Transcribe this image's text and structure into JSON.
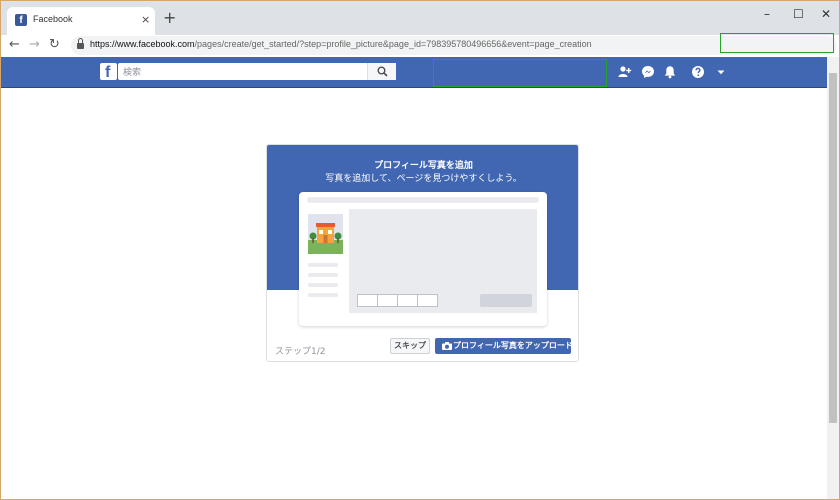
{
  "browser": {
    "tab_title": "Facebook",
    "tab_close": "×",
    "new_tab": "+",
    "minimize": "–",
    "maximize": "☐",
    "close": "✕",
    "url_host": "https://www.facebook.com",
    "url_path": "/pages/create/get_started/?step=profile_picture&page_id=798395780496656&event=page_creation"
  },
  "fb_header": {
    "logo_letter": "f",
    "search_placeholder": "検索"
  },
  "card": {
    "title": "プロフィール写真を追加",
    "subtitle": "写真を追加して、ページを見つけやすくしよう。",
    "step": "ステップ1/2",
    "skip": "スキップ",
    "upload": "プロフィール写真をアップロード"
  },
  "colors": {
    "fb_blue": "#4267b2",
    "highlight_green": "#27a327"
  },
  "icons": {
    "friend_requests": "friends-icon",
    "messenger": "messenger-icon",
    "notifications": "bell-icon",
    "help": "help-icon",
    "menu": "dropdown-arrow-icon"
  }
}
